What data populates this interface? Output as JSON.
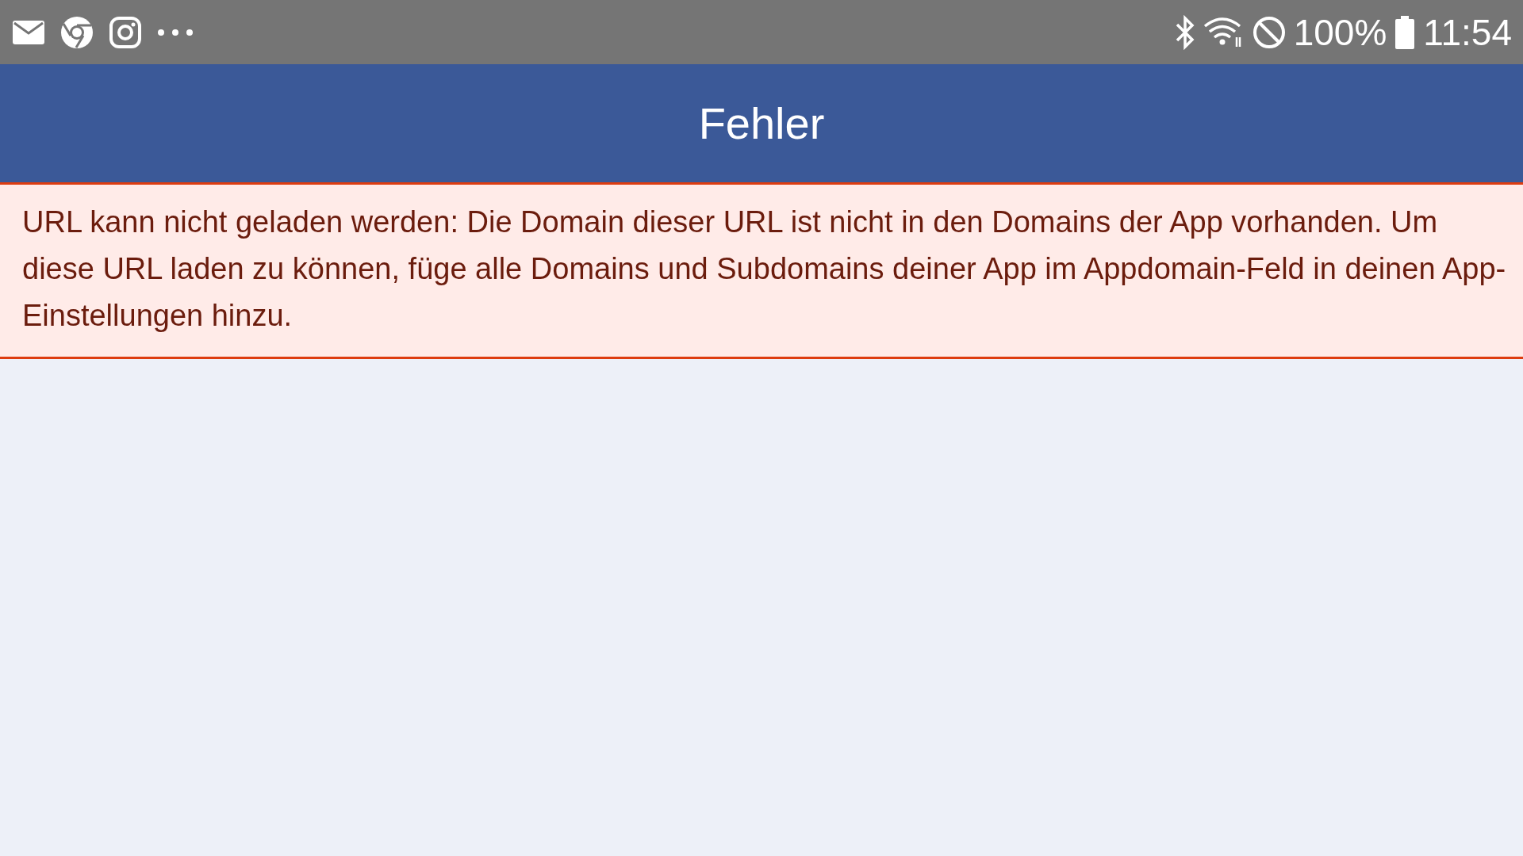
{
  "status_bar": {
    "battery": "100%",
    "time": "11:54"
  },
  "header": {
    "title": "Fehler"
  },
  "error": {
    "message": "URL kann nicht geladen werden: Die Domain dieser URL ist nicht in den Domains der App vorhanden. Um diese URL laden zu können, füge alle Domains und Subdomains deiner App im Appdomain-Feld in deinen App-Einstellungen hinzu."
  }
}
